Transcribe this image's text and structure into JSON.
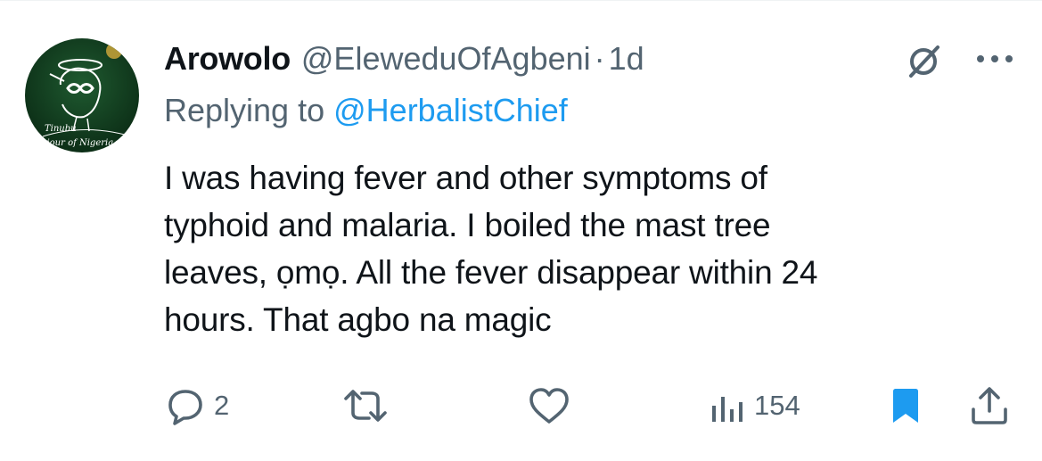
{
  "tweet": {
    "display_name": "Arowolo",
    "handle": "@EleweduOfAgbeni",
    "separator": "·",
    "time": "1d",
    "replying_prefix": "Replying to",
    "replying_to": "@HerbalistChief",
    "text": "I was having fever and other symptoms of\ntyphoid and malaria. I boiled the mast tree\nleaves, ọmọ. All the fever disappear within 24\nhours. That agbo na magic"
  },
  "avatar": {
    "caption_line1": "Tinubu",
    "caption_line2": "Saviour of Nigeria",
    "background": "#0d3a1e",
    "accent": "#2f8a3e"
  },
  "actions": {
    "reply_count": "2",
    "retweet_count": "",
    "like_count": "",
    "views_count": "154",
    "bookmarked": true
  },
  "icons": {
    "grok": "grok-icon",
    "more": "more-icon",
    "reply": "reply-icon",
    "retweet": "retweet-icon",
    "like": "like-icon",
    "views": "views-icon",
    "bookmark": "bookmark-icon",
    "share": "share-icon"
  },
  "colors": {
    "text_primary": "#0f1419",
    "text_secondary": "#536471",
    "accent_blue": "#1d9bf0",
    "bookmark_active": "#1d9bf0"
  }
}
